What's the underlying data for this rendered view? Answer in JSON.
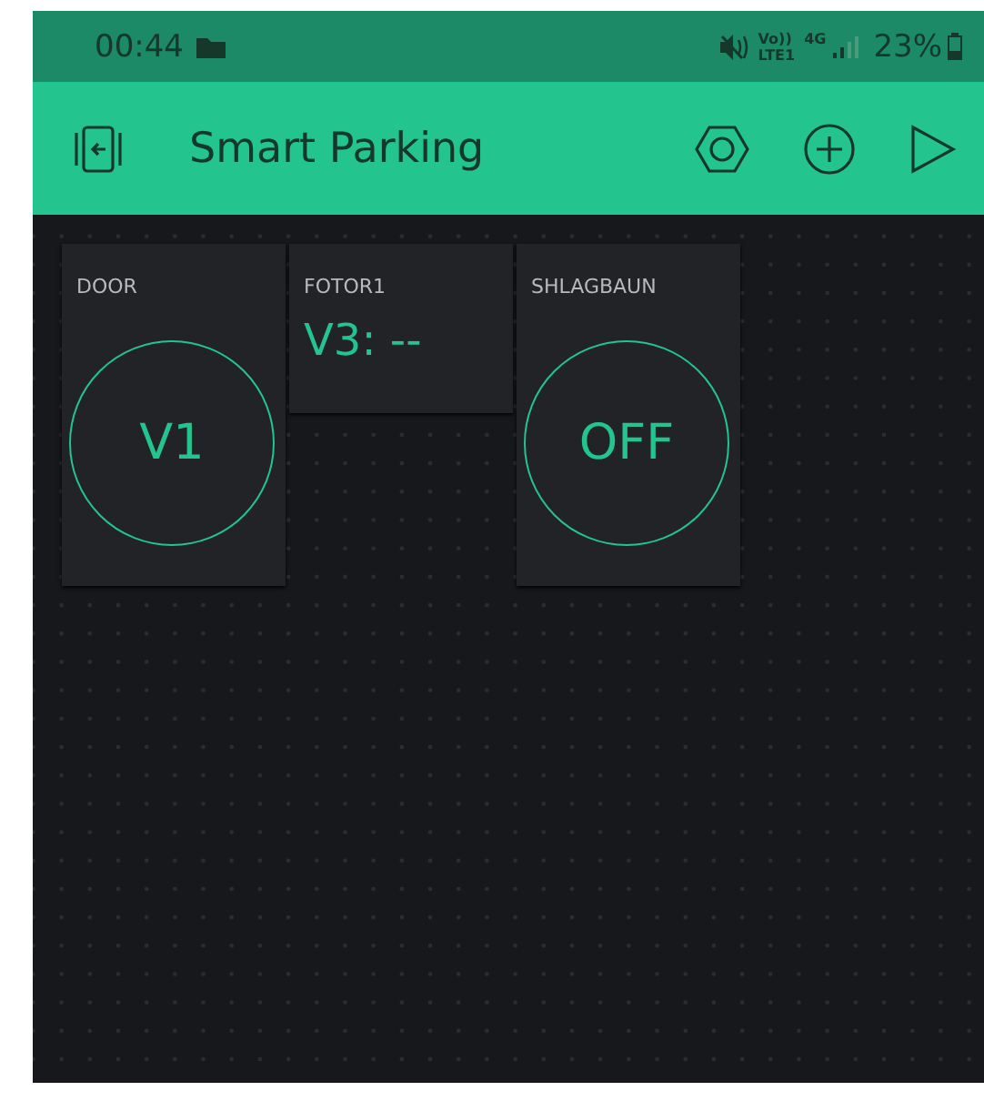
{
  "status_bar": {
    "time": "00:44",
    "network_labels": [
      "Vo))",
      "LTE1",
      "4G"
    ],
    "battery": "23%"
  },
  "app_bar": {
    "title": "Smart Parking"
  },
  "widgets": [
    {
      "kind": "button",
      "label": "DOOR",
      "value": "V1"
    },
    {
      "kind": "display",
      "label": "FOTOR1",
      "value": "V3: --"
    },
    {
      "kind": "button",
      "label": "SHLAGBAUN",
      "value": "OFF"
    }
  ]
}
